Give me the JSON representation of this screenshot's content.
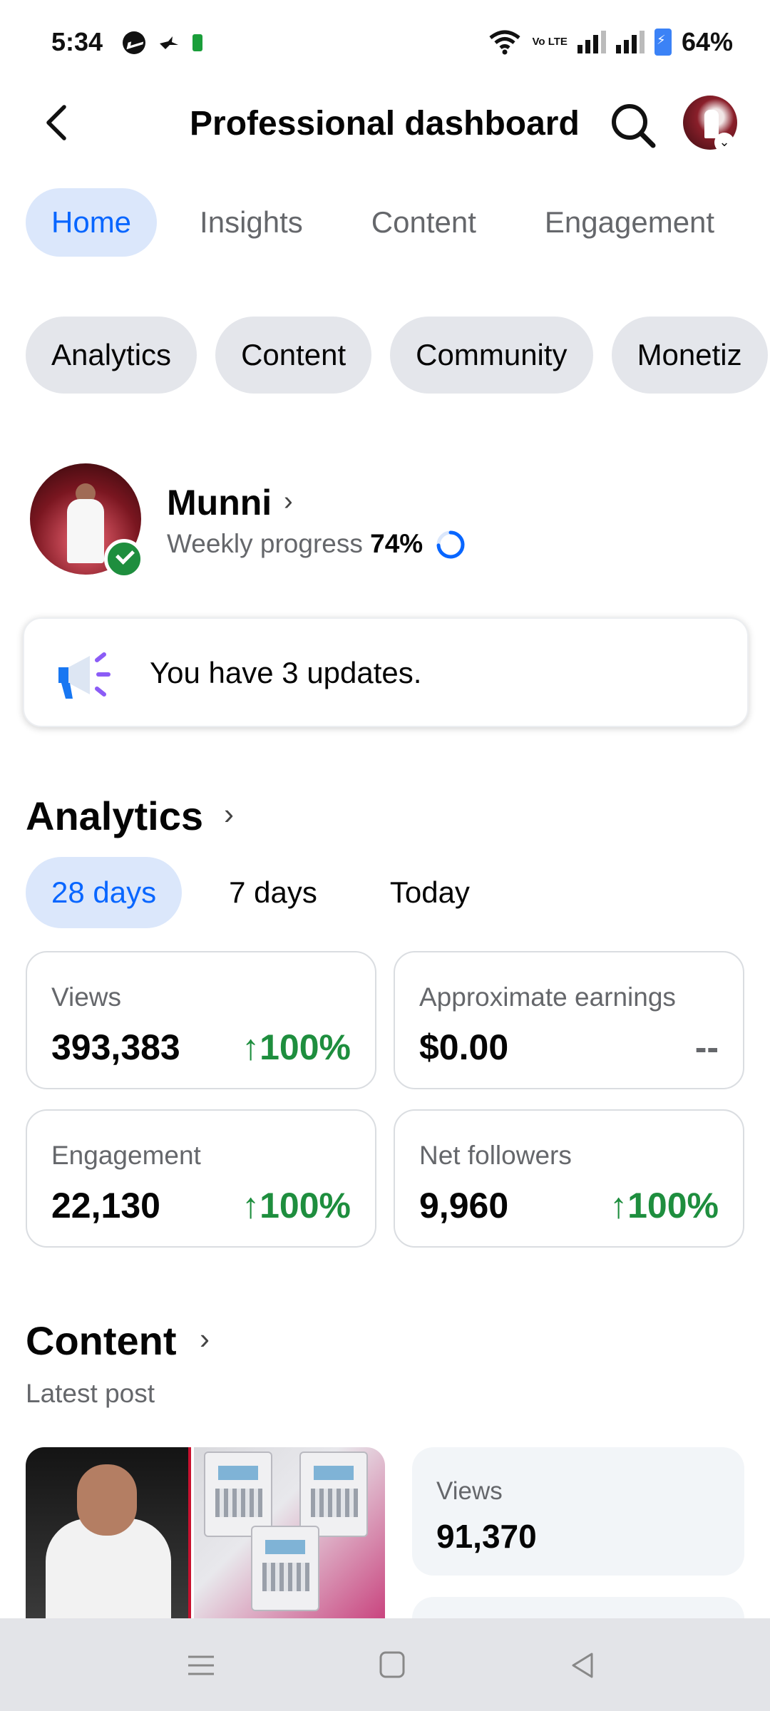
{
  "status_bar": {
    "time": "5:34",
    "network_label": "Vo LTE",
    "battery": "64%"
  },
  "header": {
    "title": "Professional dashboard"
  },
  "tabs": [
    {
      "label": "Home",
      "active": true
    },
    {
      "label": "Insights",
      "active": false
    },
    {
      "label": "Content",
      "active": false
    },
    {
      "label": "Engagement",
      "active": false
    }
  ],
  "chips": [
    "Analytics",
    "Content",
    "Community",
    "Monetiz"
  ],
  "profile": {
    "name": "Munni",
    "weekly_label": "Weekly progress",
    "weekly_value": "74%"
  },
  "updates": {
    "text": "You have 3 updates."
  },
  "analytics": {
    "title": "Analytics",
    "ranges": [
      {
        "label": "28 days",
        "active": true
      },
      {
        "label": "7 days",
        "active": false
      },
      {
        "label": "Today",
        "active": false
      }
    ],
    "metrics": [
      {
        "label": "Views",
        "value": "393,383",
        "delta": "↑100%"
      },
      {
        "label": "Approximate earnings",
        "value": "$0.00",
        "delta": "--"
      },
      {
        "label": "Engagement",
        "value": "22,130",
        "delta": "↑100%"
      },
      {
        "label": "Net followers",
        "value": "9,960",
        "delta": "↑100%"
      }
    ]
  },
  "content": {
    "title": "Content",
    "subtitle": "Latest post",
    "post_stat": {
      "label": "Views",
      "value": "91,370"
    }
  },
  "colors": {
    "accent": "#0866ff",
    "accent_bg": "#dbe7fb",
    "positive": "#1e8e3e",
    "chip_bg": "#e4e6eb"
  }
}
